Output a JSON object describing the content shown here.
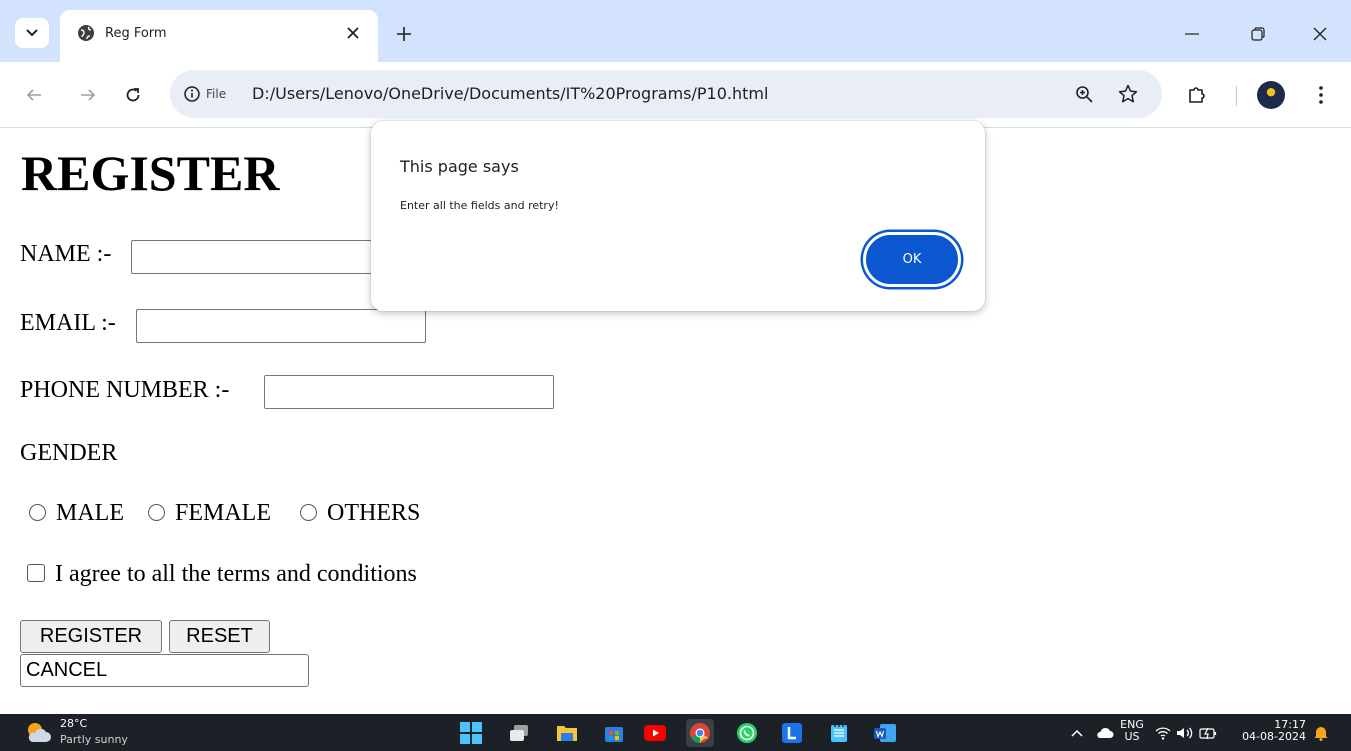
{
  "browser": {
    "tab_title": "Reg Form",
    "site_info_label": "File",
    "url": "D:/Users/Lenovo/OneDrive/Documents/IT%20Programs/P10.html"
  },
  "page": {
    "heading": "REGISTER",
    "name_label": "NAME :-",
    "email_label": "EMAIL :-",
    "phone_label": "PHONE NUMBER :-",
    "gender_label": "GENDER",
    "gender_options": [
      "MALE",
      "FEMALE",
      "OTHERS"
    ],
    "terms_label": "I agree to all the terms and conditions",
    "register_button": "REGISTER",
    "reset_button": "RESET",
    "cancel_button": "CANCEL"
  },
  "dialog": {
    "title": "This page says",
    "message": "Enter all the fields and retry!",
    "ok_label": "OK"
  },
  "taskbar": {
    "temperature": "28°C",
    "weather": "Partly sunny",
    "language_top": "ENG",
    "language_bottom": "US",
    "time": "17:17",
    "date": "04-08-2024"
  },
  "colors": {
    "tabbar_bg": "#d3e3fd",
    "omnibox_bg": "#e9eef6",
    "dialog_button": "#0b57d0",
    "taskbar_bg": "#1c2128"
  }
}
